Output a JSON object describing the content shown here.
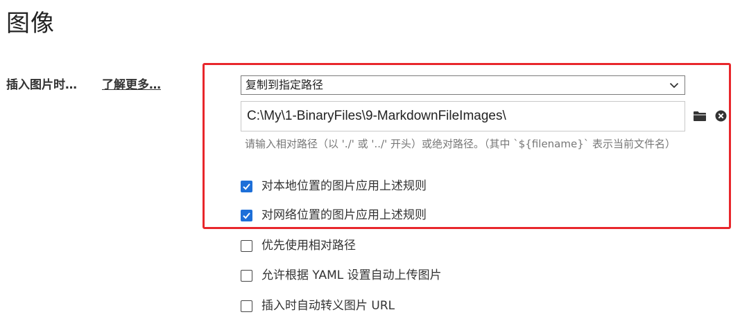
{
  "section": {
    "title": "图像"
  },
  "insert_image": {
    "label": "插入图片时…",
    "learn_more": "了解更多…",
    "action_select": {
      "value": "复制到指定路径"
    },
    "path_input": {
      "value": "C:\\My\\1-BinaryFiles\\9-MarkdownFileImages\\"
    },
    "hint": "请输入相对路径（以 './' 或 '../' 开头）或绝对路径。（其中 `${filename}` 表示当前文件名）",
    "options": [
      {
        "label": "对本地位置的图片应用上述规则",
        "checked": true
      },
      {
        "label": "对网络位置的图片应用上述规则",
        "checked": true
      },
      {
        "label": "优先使用相对路径",
        "checked": false
      },
      {
        "label": "允许根据 YAML 设置自动上传图片",
        "checked": false
      },
      {
        "label": "插入时自动转义图片 URL",
        "checked": false
      }
    ]
  },
  "colors": {
    "highlight_border": "#e8262b",
    "checkbox_checked": "#1d6fd8"
  },
  "icons": {
    "folder": "folder-icon",
    "clear": "clear-circle-x-icon",
    "dropdown": "chevron-down-icon",
    "check": "checkmark-icon"
  }
}
